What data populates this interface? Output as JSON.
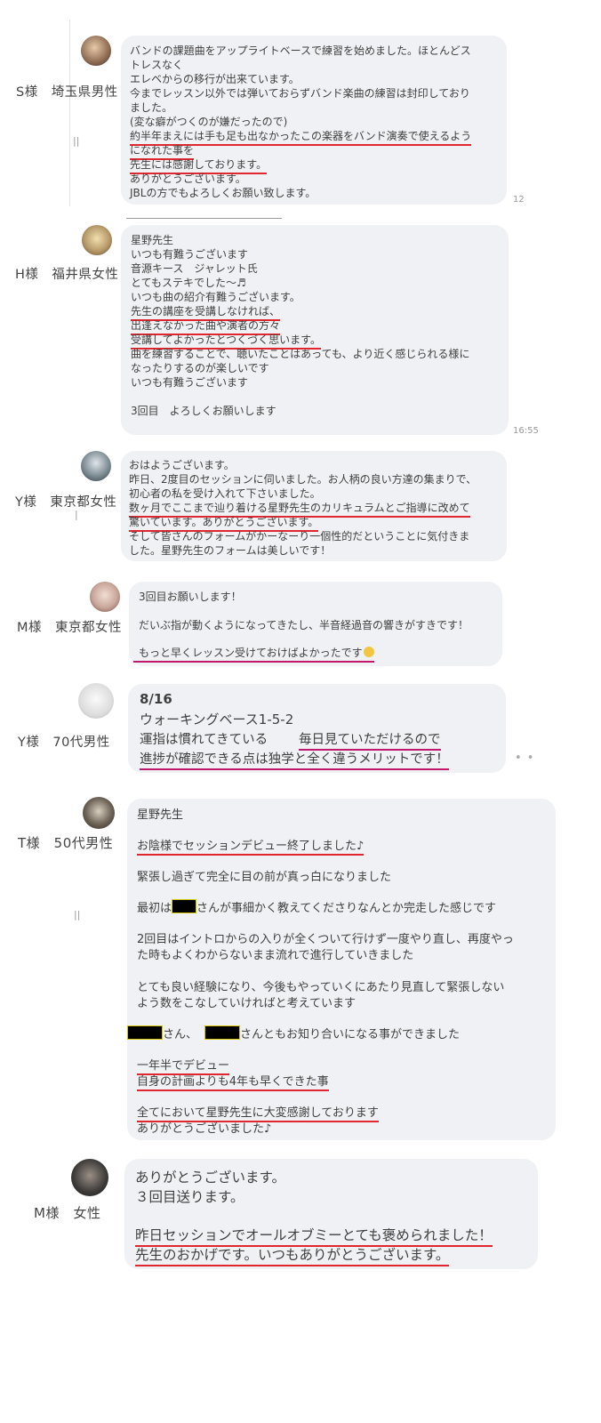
{
  "reviews": [
    {
      "label": "S様　埼玉県男性",
      "lines": [
        "バンドの課題曲をアップライトベースで練習を始めました。ほとんどス",
        "トレスなく",
        "エレベからの移行が出来ています。",
        "今までレッスン以外では弾いておらずバンド楽曲の練習は封印しており",
        "ました。",
        "(変な癖がつくのが嫌だったので)",
        "約半年まえには手も足も出なかったこの楽器をバンド演奏で使えるよう",
        "になれた事を",
        "先生には感謝しております。",
        "ありがとうございます。",
        "JBLの方でもよろしくお願い致します。"
      ],
      "time": "12"
    },
    {
      "label": "H様　福井県女性",
      "lines": [
        "星野先生",
        "いつも有難うございます",
        "音源キース　ジャレット氏",
        "とてもステキでした〜♬",
        "いつも曲の紹介有難うございます。",
        "先生の講座を受講しなければ、",
        "出逢えなかった曲や演者の方々",
        "受講してよかったとつくづく思います。",
        "曲を練習することで、聴いたことはあっても、より近く感じられる様に",
        "なったりするのが楽しいです",
        "いつも有難うございます",
        "",
        "3回目　よろしくお願いします"
      ],
      "time": "16:55"
    },
    {
      "label": "Y様　東京都女性",
      "lines": [
        "おはようございます。",
        "昨日、2度目のセッションに伺いました。お人柄の良い方達の集まりで、",
        "初心者の私を受け入れて下さいました。",
        "数ヶ月でここまで辿り着ける星野先生のカリキュラムとご指導に改めて",
        "驚いています。ありがとうございます。",
        "そして皆さんのフォームがかーなーり一個性的だということに気付きま",
        "した。星野先生のフォームは美しいです！"
      ]
    },
    {
      "label": "M様　東京都女性",
      "lines": [
        "3回目お願いします！",
        "だいぶ指が動くようになってきたし、半音経過音の響きがすきです！",
        "もっと早くレッスン受けておけばよかったです"
      ]
    },
    {
      "label": "Y様　70代男性",
      "lines": [
        "8/16",
        "ウォーキングベース1-5-2",
        "運指は慣れてきている",
        "毎日見ていただけるので",
        "進捗が確認できる点は独学と全く違うメリットです！"
      ],
      "more": "• •"
    },
    {
      "label": "T様　50代男性",
      "lines": [
        "星野先生",
        "お陰様でセッションデビュー終了しました♪",
        "緊張し過ぎて完全に目の前が真っ白になりました",
        "最初は",
        "さんが事細かく教えてくださりなんとか完走した感じです",
        "2回目はイントロからの入りが全くついて行けず一度やり直し、再度やっ",
        "た時もよくわからないまま流れで進行していきました",
        "とても良い経験になり、今後もやっていくにあたり見直して緊張しない",
        "よう数をこなしていければと考えています",
        "さん、",
        "さんともお知り合いになる事ができました",
        "一年半でデビュー",
        "自身の計画よりも4年も早くできた事",
        "全てにおいて星野先生に大変感謝しております",
        "ありがとうございました♪"
      ]
    },
    {
      "label": "M様　女性",
      "lines": [
        "ありがとうございます。",
        "３回目送ります。",
        "昨日セッションでオールオブミーとても褒められました！",
        "先生のおかげです。いつもありがとうございます。"
      ]
    }
  ],
  "colors": {
    "bubble": "#f0f1f4",
    "underline_red": "#e0262e",
    "underline_magenta": "#c0186a",
    "avatars": [
      "#8c6a52",
      "#b89a6a",
      "#7e8c94",
      "#c9a79a",
      "#dddddd",
      "#6d6256",
      "#3c3a38"
    ]
  },
  "icons": [
    "avatar-photo",
    "double-bar-glyph",
    "music-note",
    "smile-emoji",
    "redaction-box"
  ]
}
